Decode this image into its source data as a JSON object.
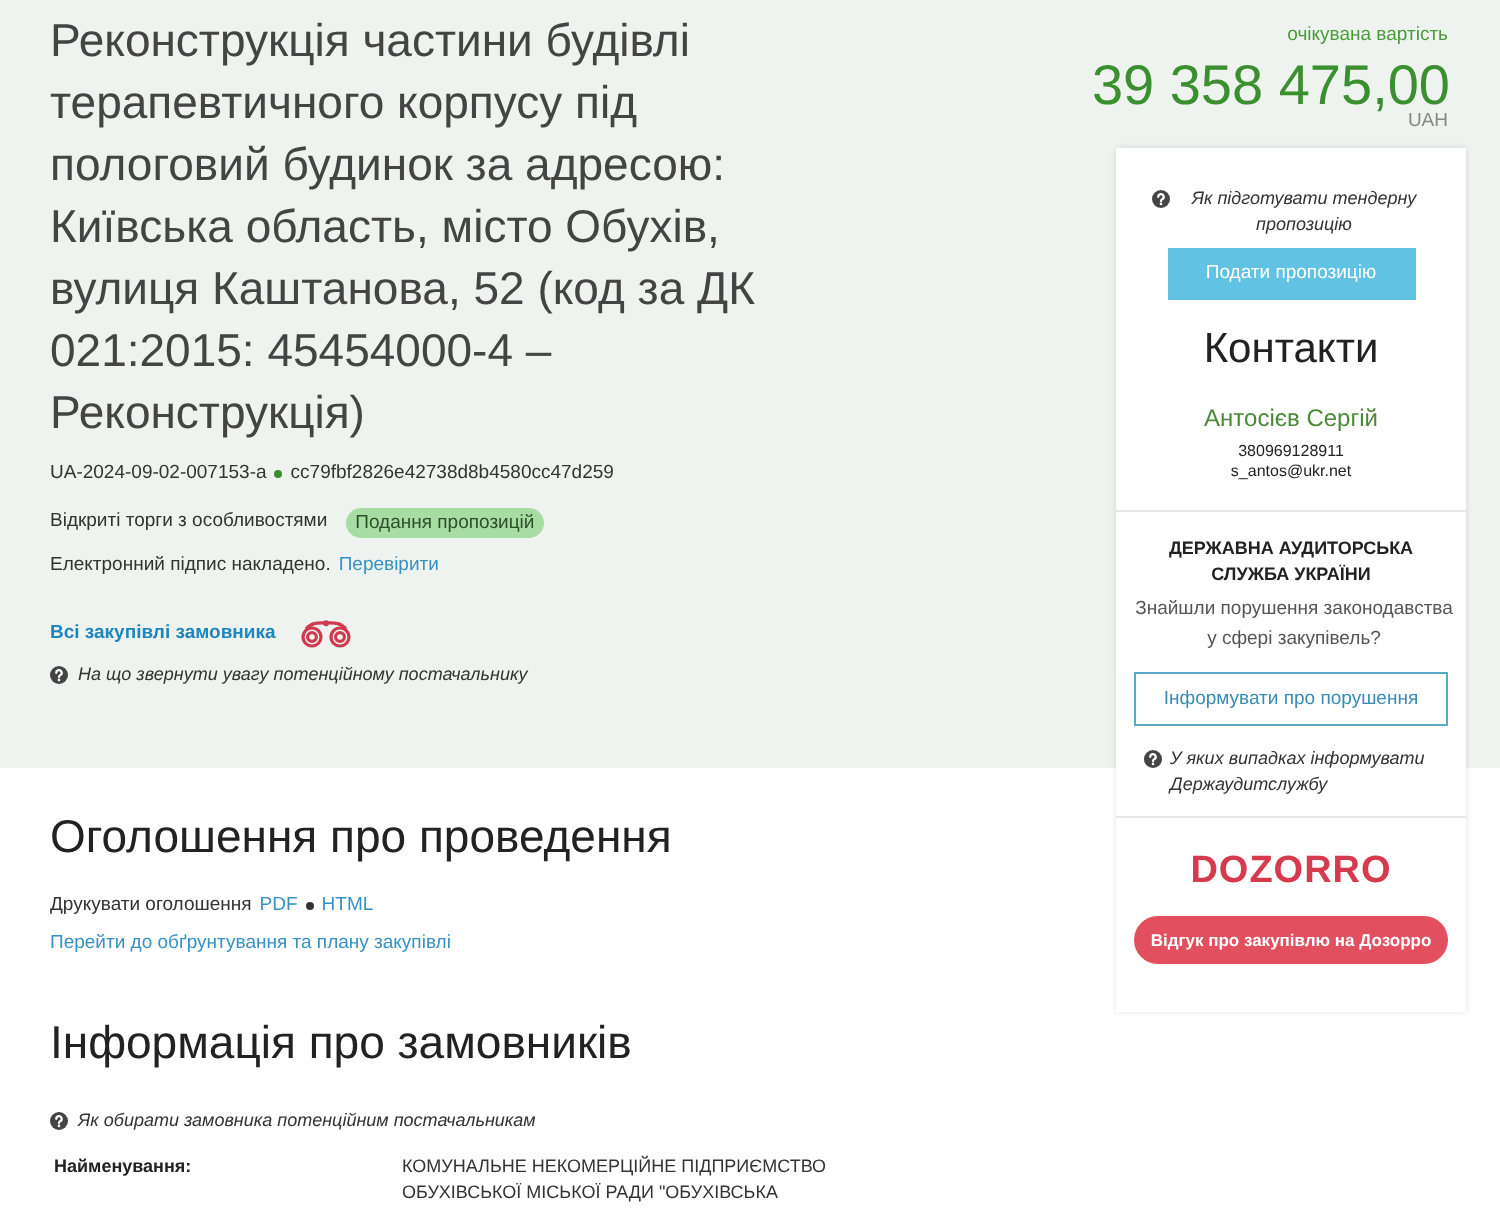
{
  "tender": {
    "title": "Реконструкція частини будівлі терапевтичного корпусу під пологовий будинок за адресою: Київська область, місто Обухів, вулиця Каштанова, 52 (код за ДК 021:2015: 45454000-4 – Реконструкція)",
    "id": "UA-2024-09-02-007153-a",
    "hash": "cc79fbf2826e42738d8b4580cc47d259",
    "procedure": "Відкриті торги з особливостями",
    "status": "Подання пропозицій",
    "signature_text": "Електронний підпис накладено.",
    "signature_link": "Перевірити",
    "buyer_link": "Всі закупівлі замовника",
    "hint": "На що звернути увагу потенційному постачальнику"
  },
  "budget": {
    "label": "очікувана вартість",
    "amount": "39 358 475,00",
    "currency": "UAH"
  },
  "sidebar": {
    "hint": "Як підготувати тендерну пропозицію",
    "submit_button": "Подати пропозицію",
    "contacts_title": "Контакти",
    "contact_name": "Антосієв Сергій",
    "phone": "380969128911",
    "email": "s_antos@ukr.net",
    "audit_title": "ДЕРЖАВНА АУДИТОРСЬКА СЛУЖБА УКРАЇНИ",
    "audit_question": "Знайшли порушення законодавства у сфері закупівель?",
    "report_button": "Інформувати про порушення",
    "audit_hint": "У яких випадках інформувати Держаудитслужбу",
    "logo": "DOZORRO",
    "feedback_button": "Відгук про закупівлю на Дозорро"
  },
  "announcement": {
    "title": "Оголошення про проведення",
    "print_label": "Друкувати оголошення",
    "print_links": [
      "PDF",
      "HTML"
    ],
    "plan_link": "Перейти до обґрунтування та плану закупівлі"
  },
  "buyers": {
    "title": "Інформація про замовників",
    "hint": "Як обирати замовника потенційним постачальникам",
    "fields": [
      {
        "label": "Найменування:",
        "value": "КОМУНАЛЬНЕ НЕКОМЕРЦІЙНЕ ПІДПРИЄМСТВО ОБУХІВСЬКОЇ МІСЬКОЇ РАДИ \"ОБУХІВСЬКА"
      }
    ]
  }
}
